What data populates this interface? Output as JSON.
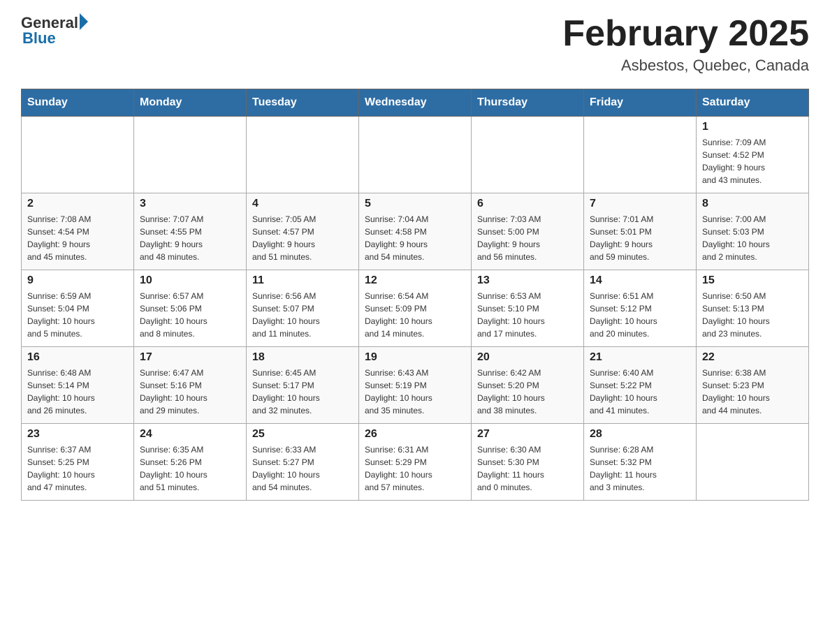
{
  "header": {
    "logo_general": "General",
    "logo_blue": "Blue",
    "month_title": "February 2025",
    "location": "Asbestos, Quebec, Canada"
  },
  "days_of_week": [
    "Sunday",
    "Monday",
    "Tuesday",
    "Wednesday",
    "Thursday",
    "Friday",
    "Saturday"
  ],
  "weeks": [
    [
      {
        "day": "",
        "info": ""
      },
      {
        "day": "",
        "info": ""
      },
      {
        "day": "",
        "info": ""
      },
      {
        "day": "",
        "info": ""
      },
      {
        "day": "",
        "info": ""
      },
      {
        "day": "",
        "info": ""
      },
      {
        "day": "1",
        "info": "Sunrise: 7:09 AM\nSunset: 4:52 PM\nDaylight: 9 hours\nand 43 minutes."
      }
    ],
    [
      {
        "day": "2",
        "info": "Sunrise: 7:08 AM\nSunset: 4:54 PM\nDaylight: 9 hours\nand 45 minutes."
      },
      {
        "day": "3",
        "info": "Sunrise: 7:07 AM\nSunset: 4:55 PM\nDaylight: 9 hours\nand 48 minutes."
      },
      {
        "day": "4",
        "info": "Sunrise: 7:05 AM\nSunset: 4:57 PM\nDaylight: 9 hours\nand 51 minutes."
      },
      {
        "day": "5",
        "info": "Sunrise: 7:04 AM\nSunset: 4:58 PM\nDaylight: 9 hours\nand 54 minutes."
      },
      {
        "day": "6",
        "info": "Sunrise: 7:03 AM\nSunset: 5:00 PM\nDaylight: 9 hours\nand 56 minutes."
      },
      {
        "day": "7",
        "info": "Sunrise: 7:01 AM\nSunset: 5:01 PM\nDaylight: 9 hours\nand 59 minutes."
      },
      {
        "day": "8",
        "info": "Sunrise: 7:00 AM\nSunset: 5:03 PM\nDaylight: 10 hours\nand 2 minutes."
      }
    ],
    [
      {
        "day": "9",
        "info": "Sunrise: 6:59 AM\nSunset: 5:04 PM\nDaylight: 10 hours\nand 5 minutes."
      },
      {
        "day": "10",
        "info": "Sunrise: 6:57 AM\nSunset: 5:06 PM\nDaylight: 10 hours\nand 8 minutes."
      },
      {
        "day": "11",
        "info": "Sunrise: 6:56 AM\nSunset: 5:07 PM\nDaylight: 10 hours\nand 11 minutes."
      },
      {
        "day": "12",
        "info": "Sunrise: 6:54 AM\nSunset: 5:09 PM\nDaylight: 10 hours\nand 14 minutes."
      },
      {
        "day": "13",
        "info": "Sunrise: 6:53 AM\nSunset: 5:10 PM\nDaylight: 10 hours\nand 17 minutes."
      },
      {
        "day": "14",
        "info": "Sunrise: 6:51 AM\nSunset: 5:12 PM\nDaylight: 10 hours\nand 20 minutes."
      },
      {
        "day": "15",
        "info": "Sunrise: 6:50 AM\nSunset: 5:13 PM\nDaylight: 10 hours\nand 23 minutes."
      }
    ],
    [
      {
        "day": "16",
        "info": "Sunrise: 6:48 AM\nSunset: 5:14 PM\nDaylight: 10 hours\nand 26 minutes."
      },
      {
        "day": "17",
        "info": "Sunrise: 6:47 AM\nSunset: 5:16 PM\nDaylight: 10 hours\nand 29 minutes."
      },
      {
        "day": "18",
        "info": "Sunrise: 6:45 AM\nSunset: 5:17 PM\nDaylight: 10 hours\nand 32 minutes."
      },
      {
        "day": "19",
        "info": "Sunrise: 6:43 AM\nSunset: 5:19 PM\nDaylight: 10 hours\nand 35 minutes."
      },
      {
        "day": "20",
        "info": "Sunrise: 6:42 AM\nSunset: 5:20 PM\nDaylight: 10 hours\nand 38 minutes."
      },
      {
        "day": "21",
        "info": "Sunrise: 6:40 AM\nSunset: 5:22 PM\nDaylight: 10 hours\nand 41 minutes."
      },
      {
        "day": "22",
        "info": "Sunrise: 6:38 AM\nSunset: 5:23 PM\nDaylight: 10 hours\nand 44 minutes."
      }
    ],
    [
      {
        "day": "23",
        "info": "Sunrise: 6:37 AM\nSunset: 5:25 PM\nDaylight: 10 hours\nand 47 minutes."
      },
      {
        "day": "24",
        "info": "Sunrise: 6:35 AM\nSunset: 5:26 PM\nDaylight: 10 hours\nand 51 minutes."
      },
      {
        "day": "25",
        "info": "Sunrise: 6:33 AM\nSunset: 5:27 PM\nDaylight: 10 hours\nand 54 minutes."
      },
      {
        "day": "26",
        "info": "Sunrise: 6:31 AM\nSunset: 5:29 PM\nDaylight: 10 hours\nand 57 minutes."
      },
      {
        "day": "27",
        "info": "Sunrise: 6:30 AM\nSunset: 5:30 PM\nDaylight: 11 hours\nand 0 minutes."
      },
      {
        "day": "28",
        "info": "Sunrise: 6:28 AM\nSunset: 5:32 PM\nDaylight: 11 hours\nand 3 minutes."
      },
      {
        "day": "",
        "info": ""
      }
    ]
  ]
}
